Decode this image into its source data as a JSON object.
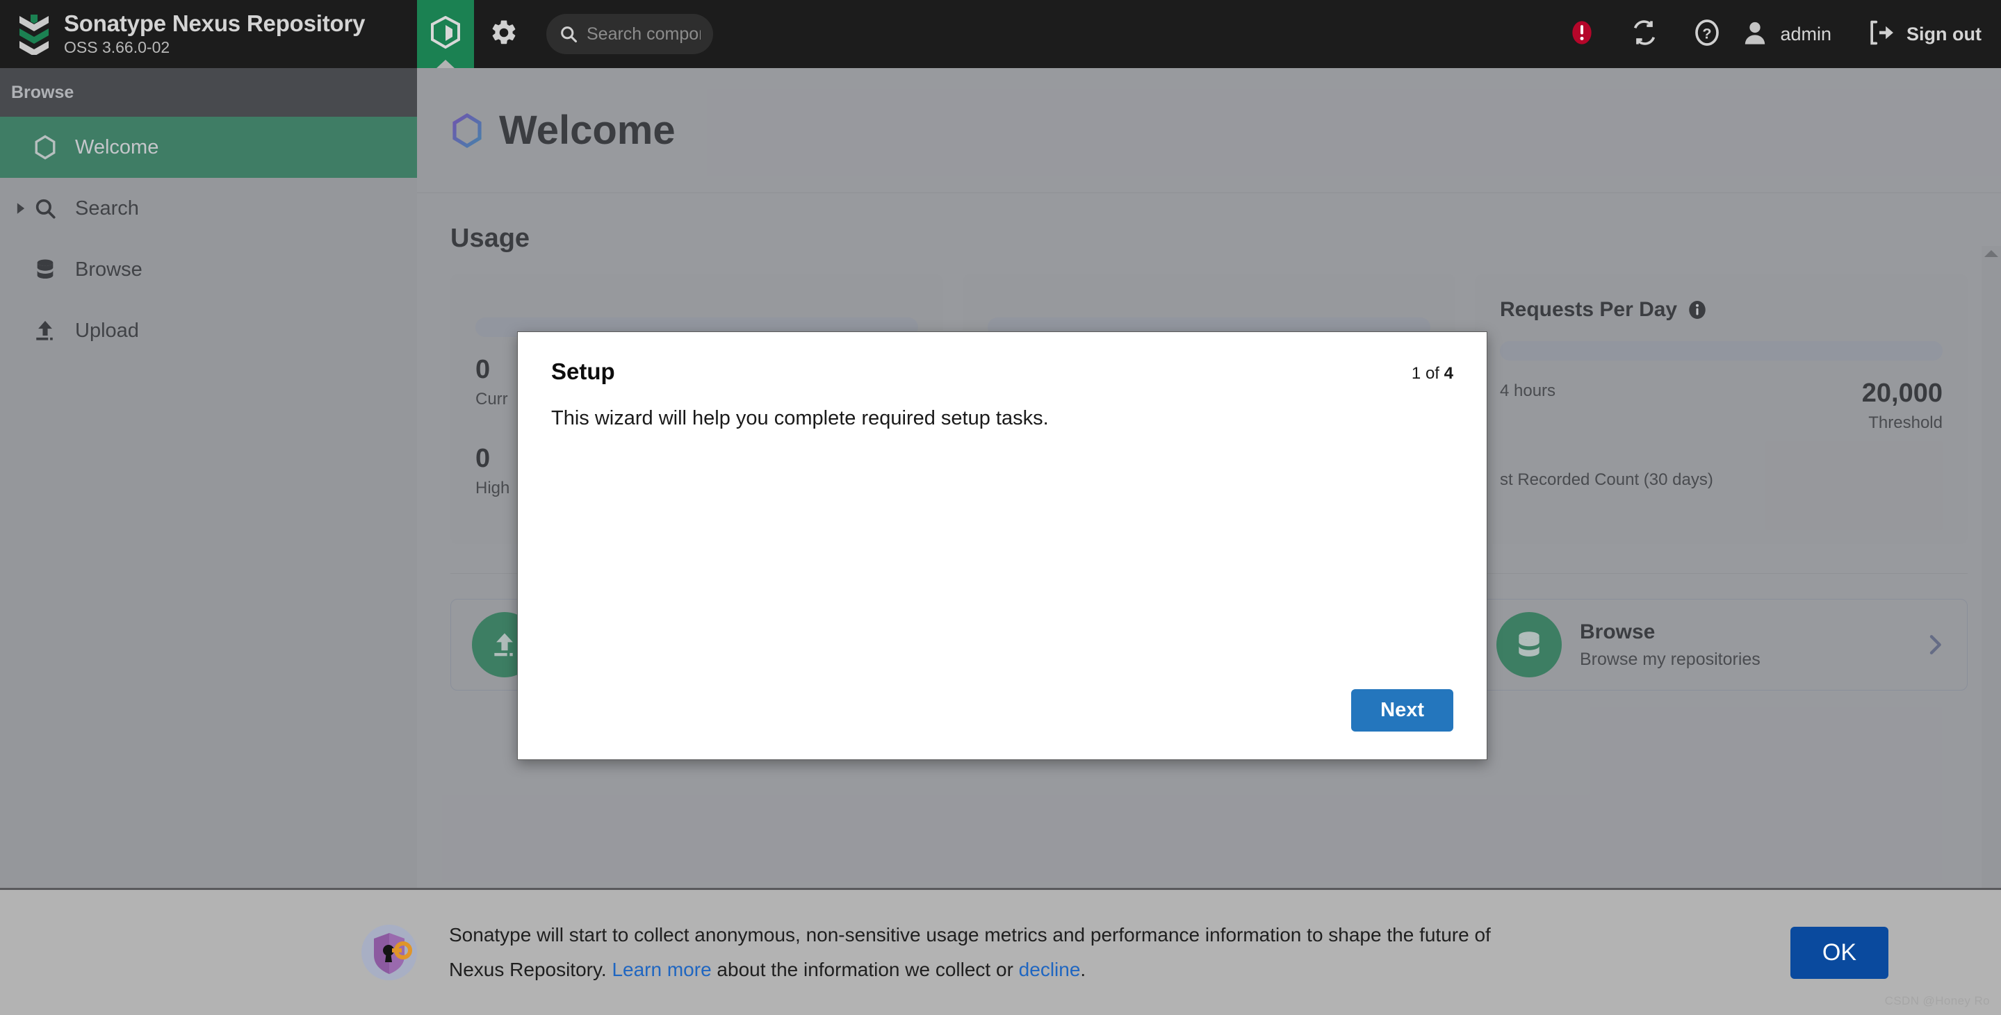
{
  "header": {
    "brand_title": "Sonatype Nexus Repository",
    "brand_version": "OSS 3.66.0-02",
    "logo_icon": "sonatype-chevron-logo",
    "cube_tab_icon": "cube-icon",
    "gear_icon": "gear-icon",
    "search": {
      "icon": "search-icon",
      "placeholder": "Search components",
      "value": ""
    },
    "alert_icon": "error-alert-icon",
    "alert_color": "#b5062a",
    "refresh_icon": "refresh-icon",
    "help_icon": "help-question-icon",
    "user_icon": "user-avatar-icon",
    "user_label": "admin",
    "signout_icon": "sign-out-icon",
    "signout_label": "Sign out"
  },
  "sidebar": {
    "section_label": "Browse",
    "items": [
      {
        "label": "Welcome",
        "icon": "hexagon-icon",
        "active": true,
        "expandable": false
      },
      {
        "label": "Search",
        "icon": "search-icon",
        "active": false,
        "expandable": true
      },
      {
        "label": "Browse",
        "icon": "database-icon",
        "active": false,
        "expandable": false
      },
      {
        "label": "Upload",
        "icon": "upload-icon",
        "active": false,
        "expandable": false
      }
    ],
    "active_color": "#1b8152"
  },
  "page": {
    "title": "Welcome",
    "title_icon": "hexagon-gradient-icon",
    "section_title": "Usage"
  },
  "usage_cards": [
    {
      "title": "",
      "stats": [
        {
          "value": "0",
          "label": "Curr"
        },
        {
          "value": "0",
          "label": "High"
        }
      ]
    },
    {
      "title": "",
      "stats": []
    },
    {
      "title": "Requests Per Day",
      "info_icon": "info-icon",
      "stats": [
        {
          "value": "",
          "label": "4 hours"
        },
        {
          "value": "20,000",
          "label": "Threshold"
        },
        {
          "value": "",
          "label": "st Recorded Count (30 days)"
        }
      ]
    }
  ],
  "tiles": [
    {
      "title": "",
      "subtitle": "",
      "icon": "upload-circle-icon",
      "chevron": "chevron-right-icon"
    },
    {
      "title": "",
      "subtitle": "",
      "icon": "search-circle-icon",
      "chevron": "chevron-right-icon"
    },
    {
      "title": "Browse",
      "subtitle": "Browse my repositories",
      "icon": "database-circle-icon",
      "chevron": "chevron-right-icon"
    }
  ],
  "modal": {
    "title": "Setup",
    "step": "1 of 4",
    "step_current": "1",
    "step_of": " of ",
    "step_total": "4",
    "body": "This wizard will help you complete required setup tasks.",
    "next_label": "Next",
    "next_color": "#2476bd"
  },
  "banner": {
    "icon": "shield-key-icon",
    "text_part1": "Sonatype will start to collect anonymous, non-sensitive usage metrics and performance information to shape the future of Nexus Repository. ",
    "link_learn_more": "Learn more",
    "text_part2": " about the information we collect or ",
    "link_decline": "decline",
    "text_part3": ".",
    "ok_label": "OK",
    "ok_color": "#0a4a9e"
  },
  "scrollbar": {
    "up_icon": "scroll-up-arrow",
    "down_icon": "scroll-down-arrow"
  },
  "watermark": "CSDN @Honey Ro"
}
